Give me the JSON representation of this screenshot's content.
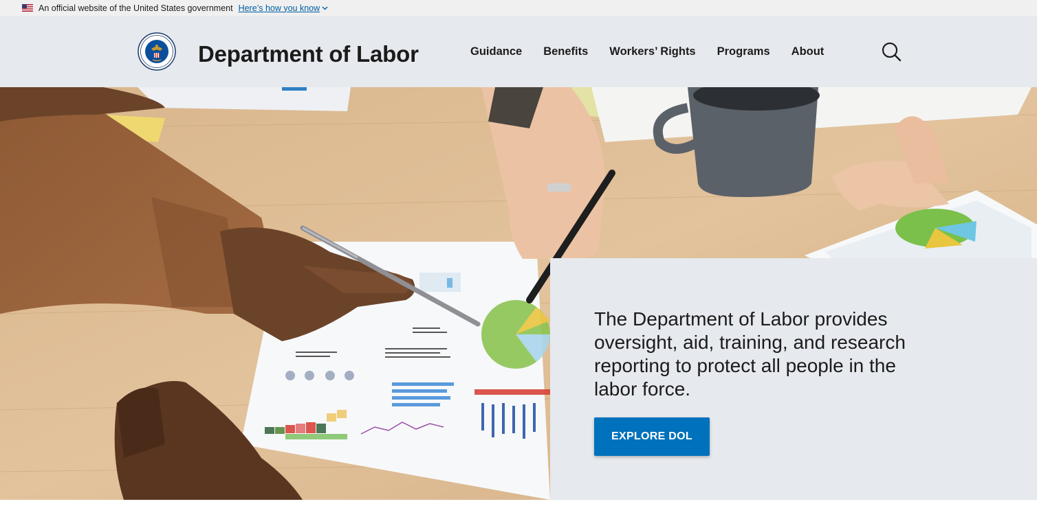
{
  "gov_banner": {
    "text": "An official website of the United States government",
    "link_label": "Here’s how you know"
  },
  "header": {
    "site_title": "Department of Labor",
    "logo_icon": "dol-seal-icon",
    "search_icon": "search-icon"
  },
  "nav": {
    "items": [
      {
        "label": "Guidance"
      },
      {
        "label": "Benefits"
      },
      {
        "label": "Workers’ Rights"
      },
      {
        "label": "Programs"
      },
      {
        "label": "About"
      }
    ]
  },
  "hero": {
    "text": "The Department of Labor provides oversight, aid, training, and research reporting to protect all people in the labor force.",
    "button_label": "EXPLORE DOL"
  },
  "colors": {
    "primary": "#0071bc",
    "header_bg": "#e6e9ed",
    "banner_bg": "#f0f0f0",
    "link": "#005ea2"
  }
}
